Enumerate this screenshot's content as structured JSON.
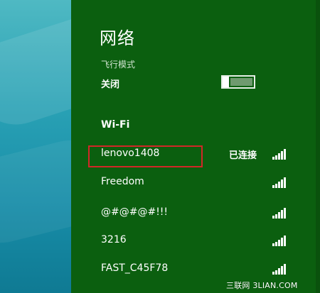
{
  "network_panel": {
    "title": "网络",
    "airplane_mode": {
      "label": "飞行模式",
      "state": "关闭"
    },
    "wifi": {
      "heading": "Wi-Fi",
      "networks": [
        {
          "name": "lenovo1408",
          "status": "已连接",
          "signal_icon": "wifi-signal-icon"
        },
        {
          "name": "Freedom",
          "status": "",
          "signal_icon": "wifi-signal-icon"
        },
        {
          "name": "@#@#@#!!!",
          "status": "",
          "signal_icon": "wifi-signal-icon"
        },
        {
          "name": "3216",
          "status": "",
          "signal_icon": "wifi-signal-icon"
        },
        {
          "name": "FAST_C45F78",
          "status": "",
          "signal_icon": "wifi-signal-icon"
        }
      ]
    }
  },
  "watermark": {
    "text_a": "三联网",
    "text_b": "3LIAN.COM"
  },
  "colors": {
    "panel_bg": "#0b5f0f",
    "highlight_border": "#d22727",
    "desktop_accent": "#2aa2b5"
  }
}
